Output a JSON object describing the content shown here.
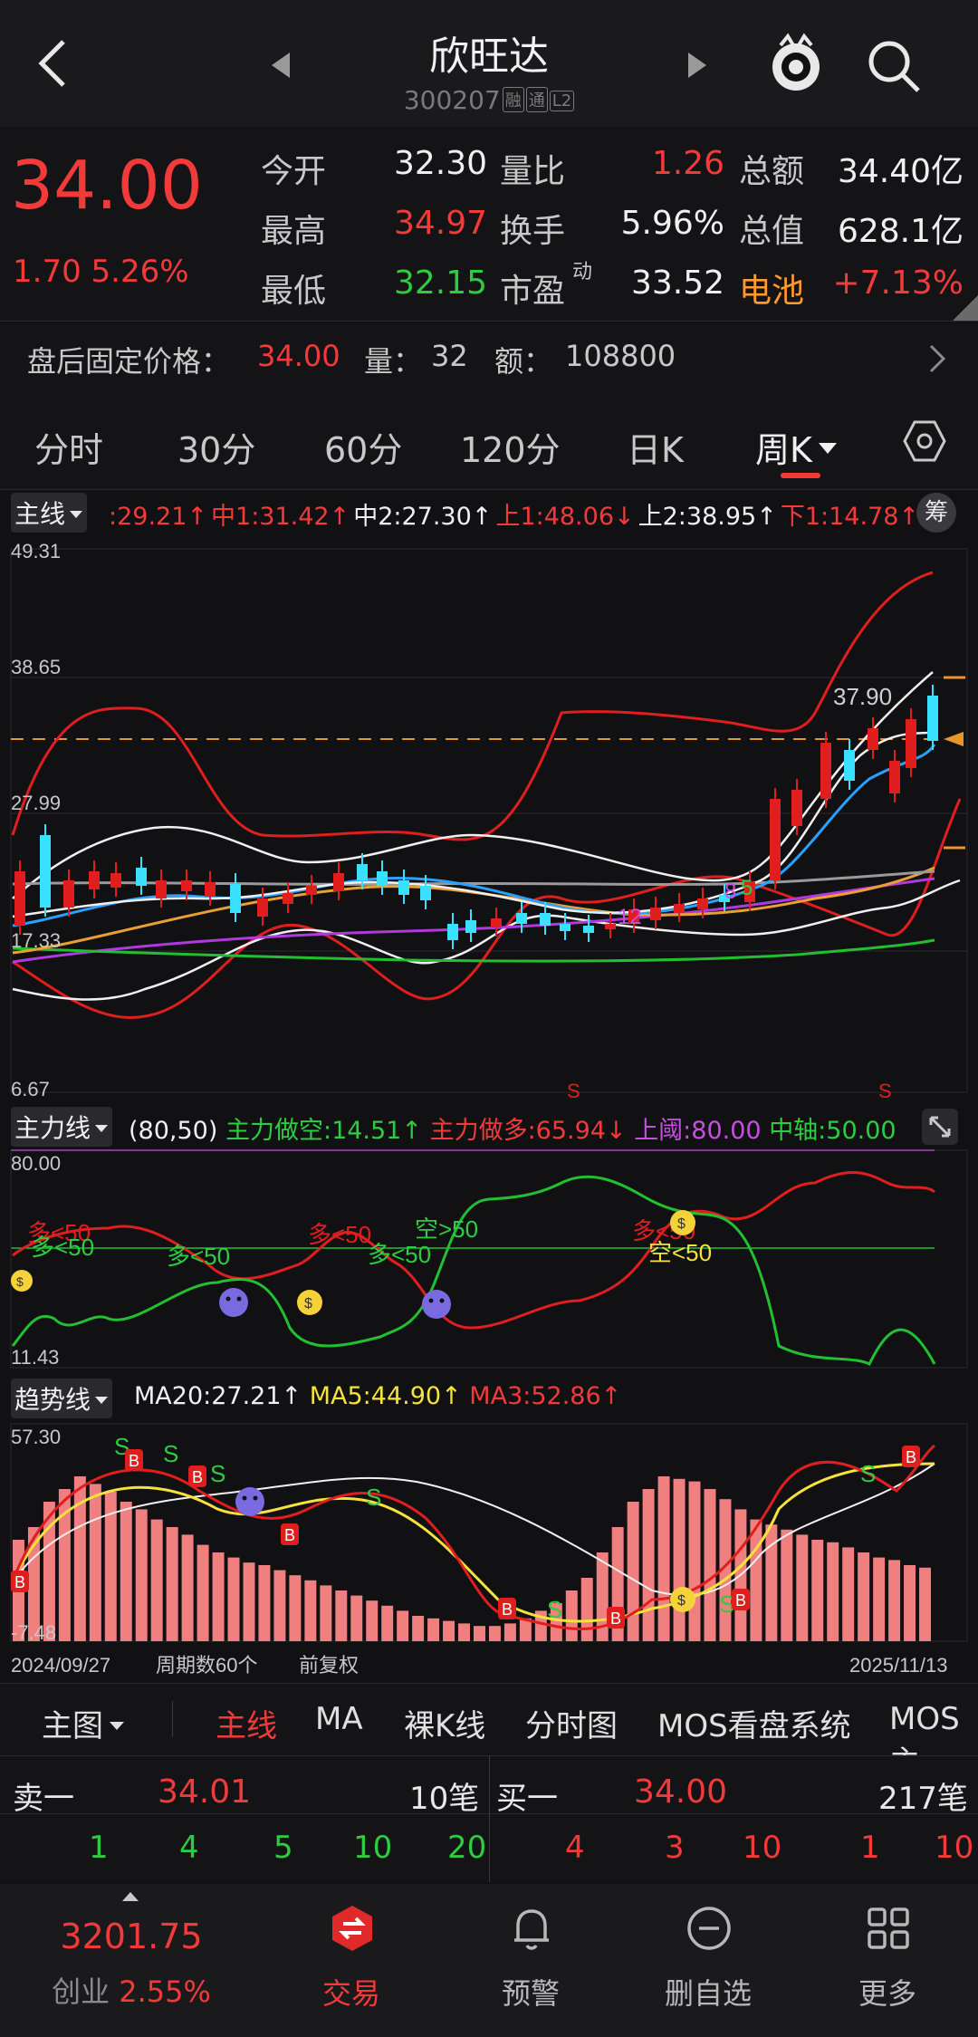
{
  "header": {
    "title": "欣旺达",
    "code": "300207",
    "tag1": "融",
    "tag2": "通",
    "tag3": "L2"
  },
  "quote": {
    "price": "34.00",
    "change": "1.70",
    "change_pct": "5.26%",
    "rows": [
      {
        "l1": "今开",
        "v1": "32.30",
        "c1": "white",
        "l2": "量比",
        "v2": "1.26",
        "c2": "red",
        "l3": "总额",
        "v3": "34.40亿",
        "c3": "white"
      },
      {
        "l1": "最高",
        "v1": "34.97",
        "c1": "red",
        "l2": "换手",
        "v2": "5.96%",
        "c2": "white",
        "l3": "总值",
        "v3": "628.1亿",
        "c3": "white"
      },
      {
        "l1": "最低",
        "v1": "32.15",
        "c1": "green",
        "l2": "市盈",
        "l2sup": "动",
        "v2": "33.52",
        "c2": "white",
        "l3": "电池",
        "v3": "+7.13%",
        "c3": "red"
      }
    ],
    "after_label": "盘后固定价格：",
    "after_price": "34.00",
    "after_vol_label": "量：",
    "after_vol": "32",
    "after_amt_label": "额：",
    "after_amt": "108800"
  },
  "period_tabs": [
    "分时",
    "30分",
    "60分",
    "120分",
    "日K",
    "周K"
  ],
  "main_indicator": {
    "name": "主线",
    "values": [
      {
        "t": ":29.21↑",
        "c": "red"
      },
      {
        "t": "中1:31.42↑",
        "c": "red"
      },
      {
        "t": "中2:27.30↑",
        "c": "white"
      },
      {
        "t": "上1:48.06↓",
        "c": "red"
      },
      {
        "t": "上2:38.95↑",
        "c": "white"
      },
      {
        "t": "下1:14.78↑",
        "c": "red"
      }
    ],
    "chip_label": "筹",
    "y_top": "49.31",
    "y_2": "38.65",
    "y_3": "27.99",
    "y_4": "17.33",
    "y_bottom": "6.67",
    "high_label": "37.90",
    "markers": [
      "S",
      "S"
    ],
    "signals": [
      "12",
      "8",
      "5"
    ]
  },
  "force_indicator": {
    "name": "主力线",
    "params": "(80,50)",
    "v1": "主力做空:14.51↑",
    "v2": "主力做多:65.94↓",
    "v3": "上阈:80.00",
    "v4": "中轴:50.00",
    "y_top": "80.00",
    "y_bottom": "11.43",
    "labels": [
      "多<50",
      "多<50",
      "多<50",
      "多<50",
      "多<50",
      "空>50",
      "多<50",
      "空<50"
    ]
  },
  "trend_indicator": {
    "name": "趋势线",
    "v1": "MA20:27.21↑",
    "v2": "MA5:44.90↑",
    "v3": "MA3:52.86↑",
    "y_top": "57.30",
    "y_bottom": "-7.48",
    "date_start": "2024/09/27",
    "period_count": "周期数60个",
    "adjust": "前复权",
    "date_end": "2025/11/13",
    "s_marks": [
      "S",
      "S",
      "S",
      "S",
      "S",
      "S",
      "S"
    ],
    "b_marks": [
      "B",
      "B",
      "B",
      "B",
      "B",
      "B",
      "B",
      "B"
    ]
  },
  "chart_tabs": [
    "主图",
    "主线",
    "MA",
    "裸K线",
    "分时图",
    "MOS看盘系统",
    "MOS主"
  ],
  "order_book": {
    "sell_label": "卖一",
    "sell_price": "34.01",
    "sell_count": "10笔",
    "sell_levels": [
      "1",
      "4",
      "5",
      "10",
      "20"
    ],
    "buy_label": "买一",
    "buy_price": "34.00",
    "buy_count": "217笔",
    "buy_levels": [
      "4",
      "3",
      "10",
      "1",
      "10"
    ]
  },
  "nav": {
    "index_value": "3201.75",
    "index_name": "创业",
    "index_pct": "2.55%",
    "trade": "交易",
    "alert": "预警",
    "remove": "删自选",
    "more": "更多"
  }
}
